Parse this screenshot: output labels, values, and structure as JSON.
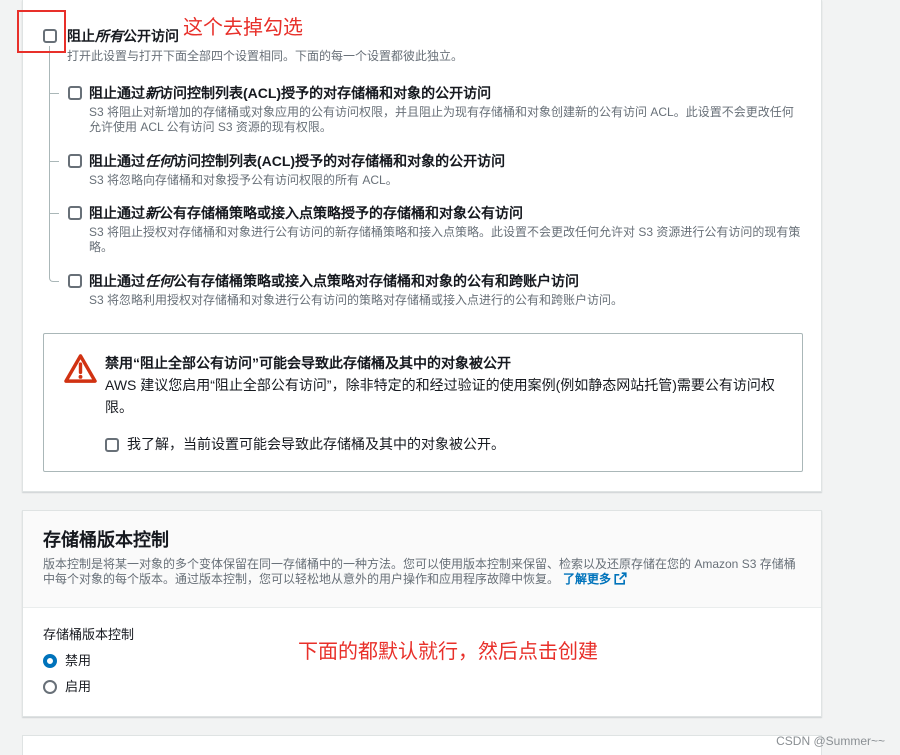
{
  "colors": {
    "page_background": "#f2f3f3",
    "text": "#16191f",
    "secondary_text": "#687078",
    "accent": "#0073bb",
    "warning": "#d13212",
    "annotation": "#e8302a"
  },
  "block_public_access": {
    "main": {
      "checked": false,
      "label_prefix": "阻止",
      "label_emphasis": "所有",
      "label_suffix": "公开访问",
      "description": "打开此设置与打开下面全部四个设置相同。下面的每一个设置都彼此独立。"
    },
    "sub_settings": [
      {
        "checked": false,
        "label_prefix": "阻止通过",
        "label_emphasis": "新",
        "label_suffix": "访问控制列表(ACL)授予的对存储桶和对象的公开访问",
        "description": "S3 将阻止对新增加的存储桶或对象应用的公有访问权限，并且阻止为现有存储桶和对象创建新的公有访问 ACL。此设置不会更改任何允许使用 ACL 公有访问 S3 资源的现有权限。"
      },
      {
        "checked": false,
        "label_prefix": "阻止通过",
        "label_emphasis": "任何",
        "label_suffix": "访问控制列表(ACL)授予的对存储桶和对象的公开访问",
        "description": "S3 将忽略向存储桶和对象授予公有访问权限的所有 ACL。"
      },
      {
        "checked": false,
        "label_prefix": "阻止通过",
        "label_emphasis": "新",
        "label_suffix": "公有存储桶策略或接入点策略授予的存储桶和对象公有访问",
        "description": "S3 将阻止授权对存储桶和对象进行公有访问的新存储桶策略和接入点策略。此设置不会更改任何允许对 S3 资源进行公有访问的现有策略。"
      },
      {
        "checked": false,
        "label_prefix": "阻止通过",
        "label_emphasis": "任何",
        "label_suffix": "公有存储桶策略或接入点策略对存储桶和对象的公有和跨账户访问",
        "description": "S3 将忽略利用授权对存储桶和对象进行公有访问的策略对存储桶或接入点进行的公有和跨账户访问。"
      }
    ]
  },
  "warning": {
    "icon": "warning-icon",
    "title": "禁用“阻止全部公有访问”可能会导致此存储桶及其中的对象被公开",
    "body": "AWS 建议您启用“阻止全部公有访问”，除非特定的和经过验证的使用案例(例如静态网站托管)需要公有访问权限。",
    "acknowledge": {
      "checked": false,
      "label": "我了解，当前设置可能会导致此存储桶及其中的对象被公开。"
    }
  },
  "versioning": {
    "title": "存储桶版本控制",
    "description": "版本控制是将某一对象的多个变体保留在同一存储桶中的一种方法。您可以使用版本控制来保留、检索以及还原存储在您的 Amazon S3 存储桶中每个对象的每个版本。通过版本控制，您可以轻松地从意外的用户操作和应用程序故障中恢复。",
    "learn_more": {
      "label": "了解更多",
      "icon": "external-link-icon"
    },
    "field_label": "存储桶版本控制",
    "options": [
      {
        "label": "禁用",
        "selected": true
      },
      {
        "label": "启用",
        "selected": false
      }
    ]
  },
  "annotations": {
    "checkbox_note": "这个去掉勾选",
    "defaults_note": "下面的都默认就行，然后点击创建"
  },
  "watermark": "CSDN @Summer~~"
}
